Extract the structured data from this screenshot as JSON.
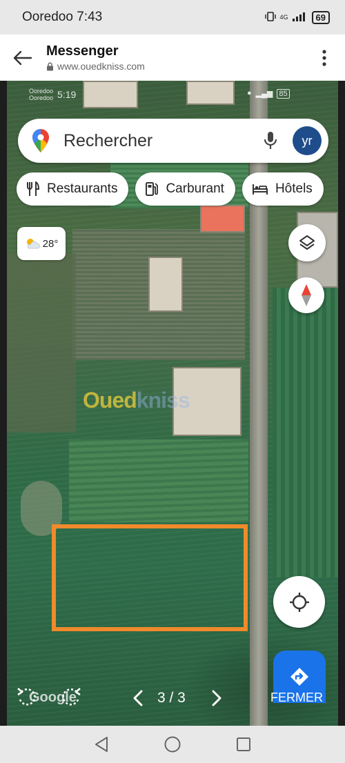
{
  "status_bar": {
    "carrier_time": "Ooredoo 7:43",
    "network": "4G",
    "battery": "69"
  },
  "app_bar": {
    "title": "Messenger",
    "url": "www.ouedkniss.com"
  },
  "embedded_screenshot": {
    "carrier": "Ooredoo\nOoredoo",
    "time": "5:19",
    "battery": "85",
    "search_placeholder": "Rechercher",
    "avatar_initials": "yr",
    "chips": [
      {
        "label": "Restaurants",
        "icon": "restaurant-icon"
      },
      {
        "label": "Carburant",
        "icon": "fuel-icon"
      },
      {
        "label": "Hôtels",
        "icon": "hotel-icon"
      }
    ],
    "temperature": "28°",
    "watermark_part1": "Oued",
    "watermark_part2": "kniss",
    "map_brand": "Google"
  },
  "viewer": {
    "counter": "3 / 3",
    "close_label": "FERMER"
  },
  "colors": {
    "selection": "#f08a2b",
    "maps_blue": "#1a73e8",
    "avatar": "#1f4d8c"
  }
}
